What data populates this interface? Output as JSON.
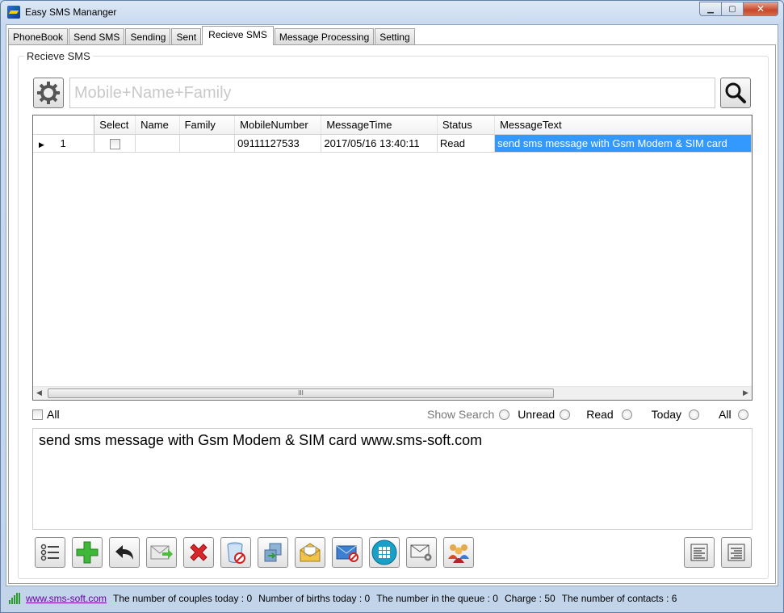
{
  "window": {
    "title": "Easy SMS Mananger"
  },
  "tabs": [
    "PhoneBook",
    "Send SMS",
    "Sending",
    "Sent",
    "Recieve SMS",
    "Message Processing",
    "Setting"
  ],
  "active_tab": "Recieve SMS",
  "groupbox_label": "Recieve SMS",
  "search": {
    "placeholder": "Mobile+Name+Family",
    "value": ""
  },
  "grid": {
    "columns": [
      "Select",
      "Name",
      "Family",
      "MobileNumber",
      "MessageTime",
      "Status",
      "MessageText"
    ],
    "rows": [
      {
        "row_number": "1",
        "select": false,
        "name": "",
        "family": "",
        "mobile": "09111127533",
        "time": "2017/05/16 13:40:11",
        "status": "Read",
        "text": "send sms message with Gsm Modem & SIM card"
      }
    ],
    "scroll_thumb_glyph": "III"
  },
  "filters": {
    "all_checkbox_label": "All",
    "show_search": "Show Search",
    "unread": "Unread",
    "read": "Read",
    "today": "Today",
    "all": "All"
  },
  "message_preview": "send sms message with Gsm Modem & SIM card www.sms-soft.com",
  "toolbar": {
    "icons": [
      "list-icon",
      "add-icon",
      "reply-icon",
      "forward-mail-icon",
      "delete-icon",
      "recycle-bin-icon",
      "database-sync-icon",
      "open-mail-icon",
      "blocked-mail-icon",
      "dialpad-icon",
      "mail-settings-icon",
      "contacts-group-icon"
    ],
    "align_icons": [
      "align-left-icon",
      "align-right-icon"
    ]
  },
  "status": {
    "link": "www.sms-soft.com",
    "couples": "The number of couples today : 0",
    "births": "Number of births today : 0",
    "queue": "The number in the queue : 0",
    "charge": "Charge : 50",
    "contacts": "The number of contacts : 6"
  },
  "colors": {
    "selection": "#3399ff",
    "link": "#6b00a6",
    "signal": "#2c9a2c"
  }
}
